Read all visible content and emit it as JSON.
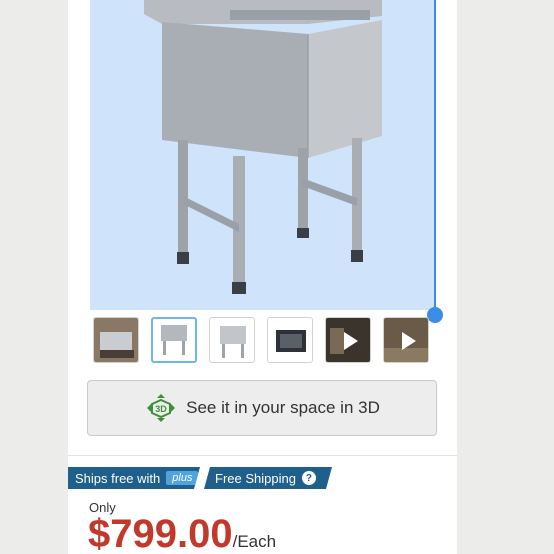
{
  "product": {
    "thumbnails": [
      {
        "name": "sink-installed-thumb",
        "type": "image"
      },
      {
        "name": "sink-front-thumb",
        "type": "image",
        "active": true
      },
      {
        "name": "sink-side-thumb",
        "type": "image"
      },
      {
        "name": "sink-top-thumb",
        "type": "image"
      },
      {
        "name": "video-thumb-1",
        "type": "video"
      },
      {
        "name": "video-thumb-2",
        "type": "video"
      }
    ],
    "view_3d_label": "See it in your space in 3D",
    "icon_3d_text": "3D"
  },
  "shipping": {
    "ships_free_label": "Ships free with",
    "plus_label": "plus",
    "free_shipping_label": "Free Shipping",
    "help_glyph": "?"
  },
  "pricing": {
    "only_label": "Only",
    "price": "$799.00",
    "unit": "/Each"
  },
  "colors": {
    "image_background": "#cfe3fb",
    "badge": "#1e5f8c",
    "price": "#c0392b",
    "selection": "#3a8ee6"
  }
}
